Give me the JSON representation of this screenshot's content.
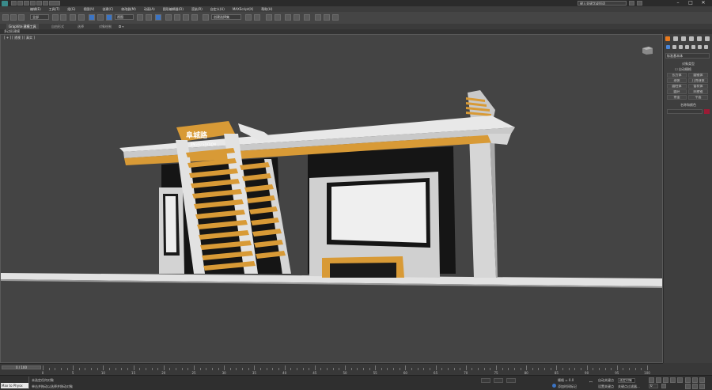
{
  "titlebar": {
    "title": "",
    "search_text": "键入关键字或短语"
  },
  "menu": {
    "items": [
      "编辑(E)",
      "工具(T)",
      "组(G)",
      "视图(V)",
      "创建(C)",
      "修改器(M)",
      "动画(A)",
      "图形编辑器(D)",
      "渲染(R)",
      "自定义(U)",
      "MAXScript(X)",
      "帮助(H)"
    ]
  },
  "toolbar": {
    "selection_filter": "全部",
    "reference_coord": "视图",
    "named_selection": "创建选择集"
  },
  "ribbon": {
    "tabs": [
      "Graphite 建模工具",
      "自由形式",
      "选择",
      "对象绘制"
    ],
    "active_tab": 0,
    "sub_label": "多边形建模"
  },
  "viewport": {
    "label": "[ + ] [ 透视 ] [ 真实 ]",
    "sign_text": "阜城路",
    "sign_subtext": "JINGFU STATION",
    "colors": {
      "roof_orange": "#D89A36",
      "roof_white": "#E4E4E4",
      "dark": "#151515",
      "grey_panel": "#CFCFCF"
    }
  },
  "command_panel": {
    "dropdown": "标准基本体",
    "section_object_type": "对象类型",
    "autogrid": "自动栅格",
    "buttons": [
      "长方体",
      "圆锥体",
      "球体",
      "几何球体",
      "圆柱体",
      "管状体",
      "圆环",
      "四棱锥",
      "茶壶",
      "平面"
    ],
    "section_name_color": "名称和颜色",
    "object_color": "#9A1B35"
  },
  "timeline": {
    "slider_text": "0 / 100",
    "ticks": [
      0,
      5,
      10,
      15,
      20,
      25,
      30,
      35,
      40,
      45,
      50,
      55,
      60,
      65,
      70,
      75,
      80,
      85,
      90,
      95,
      100
    ]
  },
  "statusbar": {
    "maxscript_label": "Max to Physx",
    "status_line1": "未选定任何对象",
    "status_line2": "单击并拖动以选择并移动对象",
    "grid_label": "栅格 = 0.0",
    "auto_key": "自动关键点",
    "selected_label": "选定对象",
    "set_key": "设置关键点",
    "key_filters": "关键点过滤器...",
    "add_time_tag": "添加时间标记",
    "frame_value": "0"
  }
}
